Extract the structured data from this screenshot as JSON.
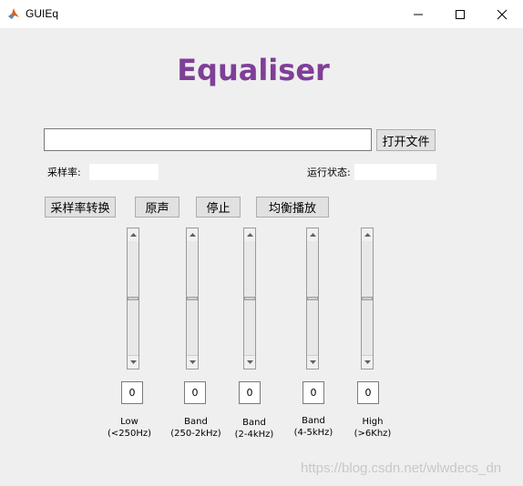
{
  "window": {
    "title": "GUIEq",
    "icon": "matlab-icon"
  },
  "heading": "Equaliser",
  "file": {
    "path_value": "",
    "open_button": "打开文件"
  },
  "sample_rate": {
    "label": "采样率:",
    "value": ""
  },
  "run_status": {
    "label": "运行状态:",
    "value": ""
  },
  "buttons": {
    "convert": "采样率转换",
    "original": "原声",
    "stop": "停止",
    "equalize_play": "均衡播放"
  },
  "bands": [
    {
      "name": "Low",
      "range": "(<250Hz)",
      "value": "0",
      "level": 0.5
    },
    {
      "name": "Band",
      "range": "(250-2kHz)",
      "value": "0",
      "level": 0.5
    },
    {
      "name": "Band",
      "range": "(2-4kHz)",
      "value": "0",
      "level": 0.5
    },
    {
      "name": "Band",
      "range": "(4-5kHz)",
      "value": "0",
      "level": 0.5
    },
    {
      "name": "High",
      "range": "(>6Khz)",
      "value": "0",
      "level": 0.5
    }
  ],
  "watermark": "https://blog.csdn.net/wlwdecs_dn",
  "colors": {
    "heading": "#7f3f98",
    "client_bg": "#efefef"
  }
}
